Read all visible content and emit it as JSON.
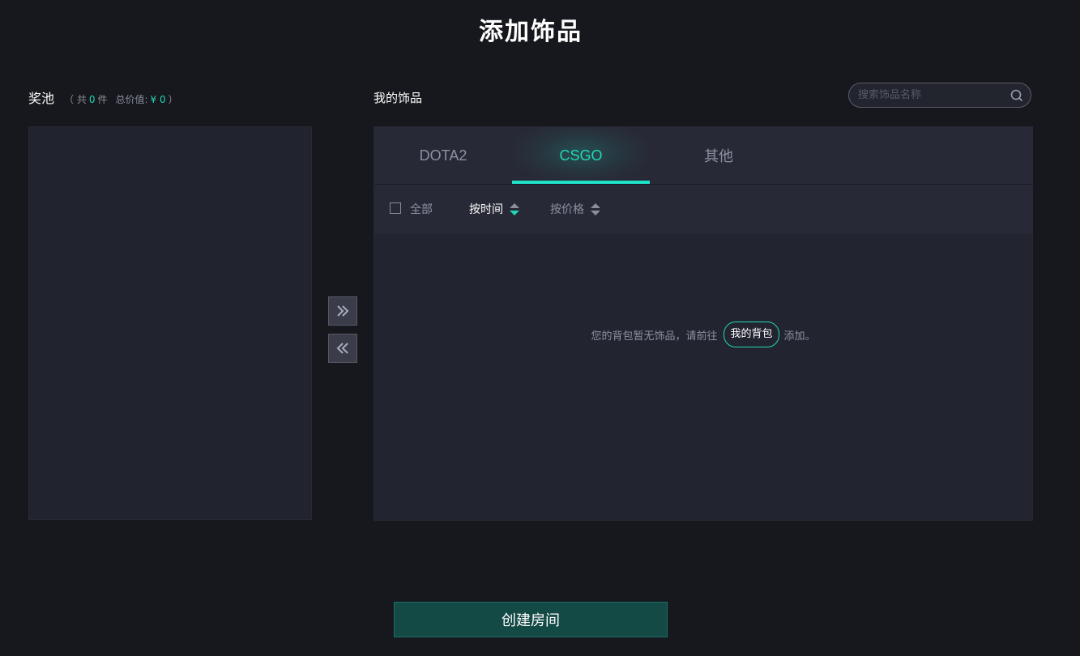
{
  "page": {
    "title": "添加饰品"
  },
  "pool": {
    "title": "奖池",
    "meta_open": "（ 共",
    "count": "0",
    "count_unit": "件",
    "total_label": "总价值:",
    "total_value": "¥ 0",
    "meta_close": "）"
  },
  "transfer": {
    "add_icon": "double-chevron-right-icon",
    "remove_icon": "double-chevron-left-icon"
  },
  "items": {
    "title": "我的饰品",
    "search_placeholder": "搜索饰品名称",
    "tabs": [
      {
        "label": "DOTA2",
        "active": false
      },
      {
        "label": "CSGO",
        "active": true
      },
      {
        "label": "其他",
        "active": false
      }
    ],
    "select_all_label": "全部",
    "sort_time_label": "按时间",
    "sort_price_label": "按价格",
    "empty_prefix": "您的背包暂无饰品，请前往",
    "backpack_link": "我的背包",
    "empty_suffix": "添加。"
  },
  "footer": {
    "create_label": "创建房间"
  },
  "colors": {
    "accent": "#22d6b3",
    "background": "#17181d",
    "panel": "#222530",
    "create_button": "#134a46"
  }
}
